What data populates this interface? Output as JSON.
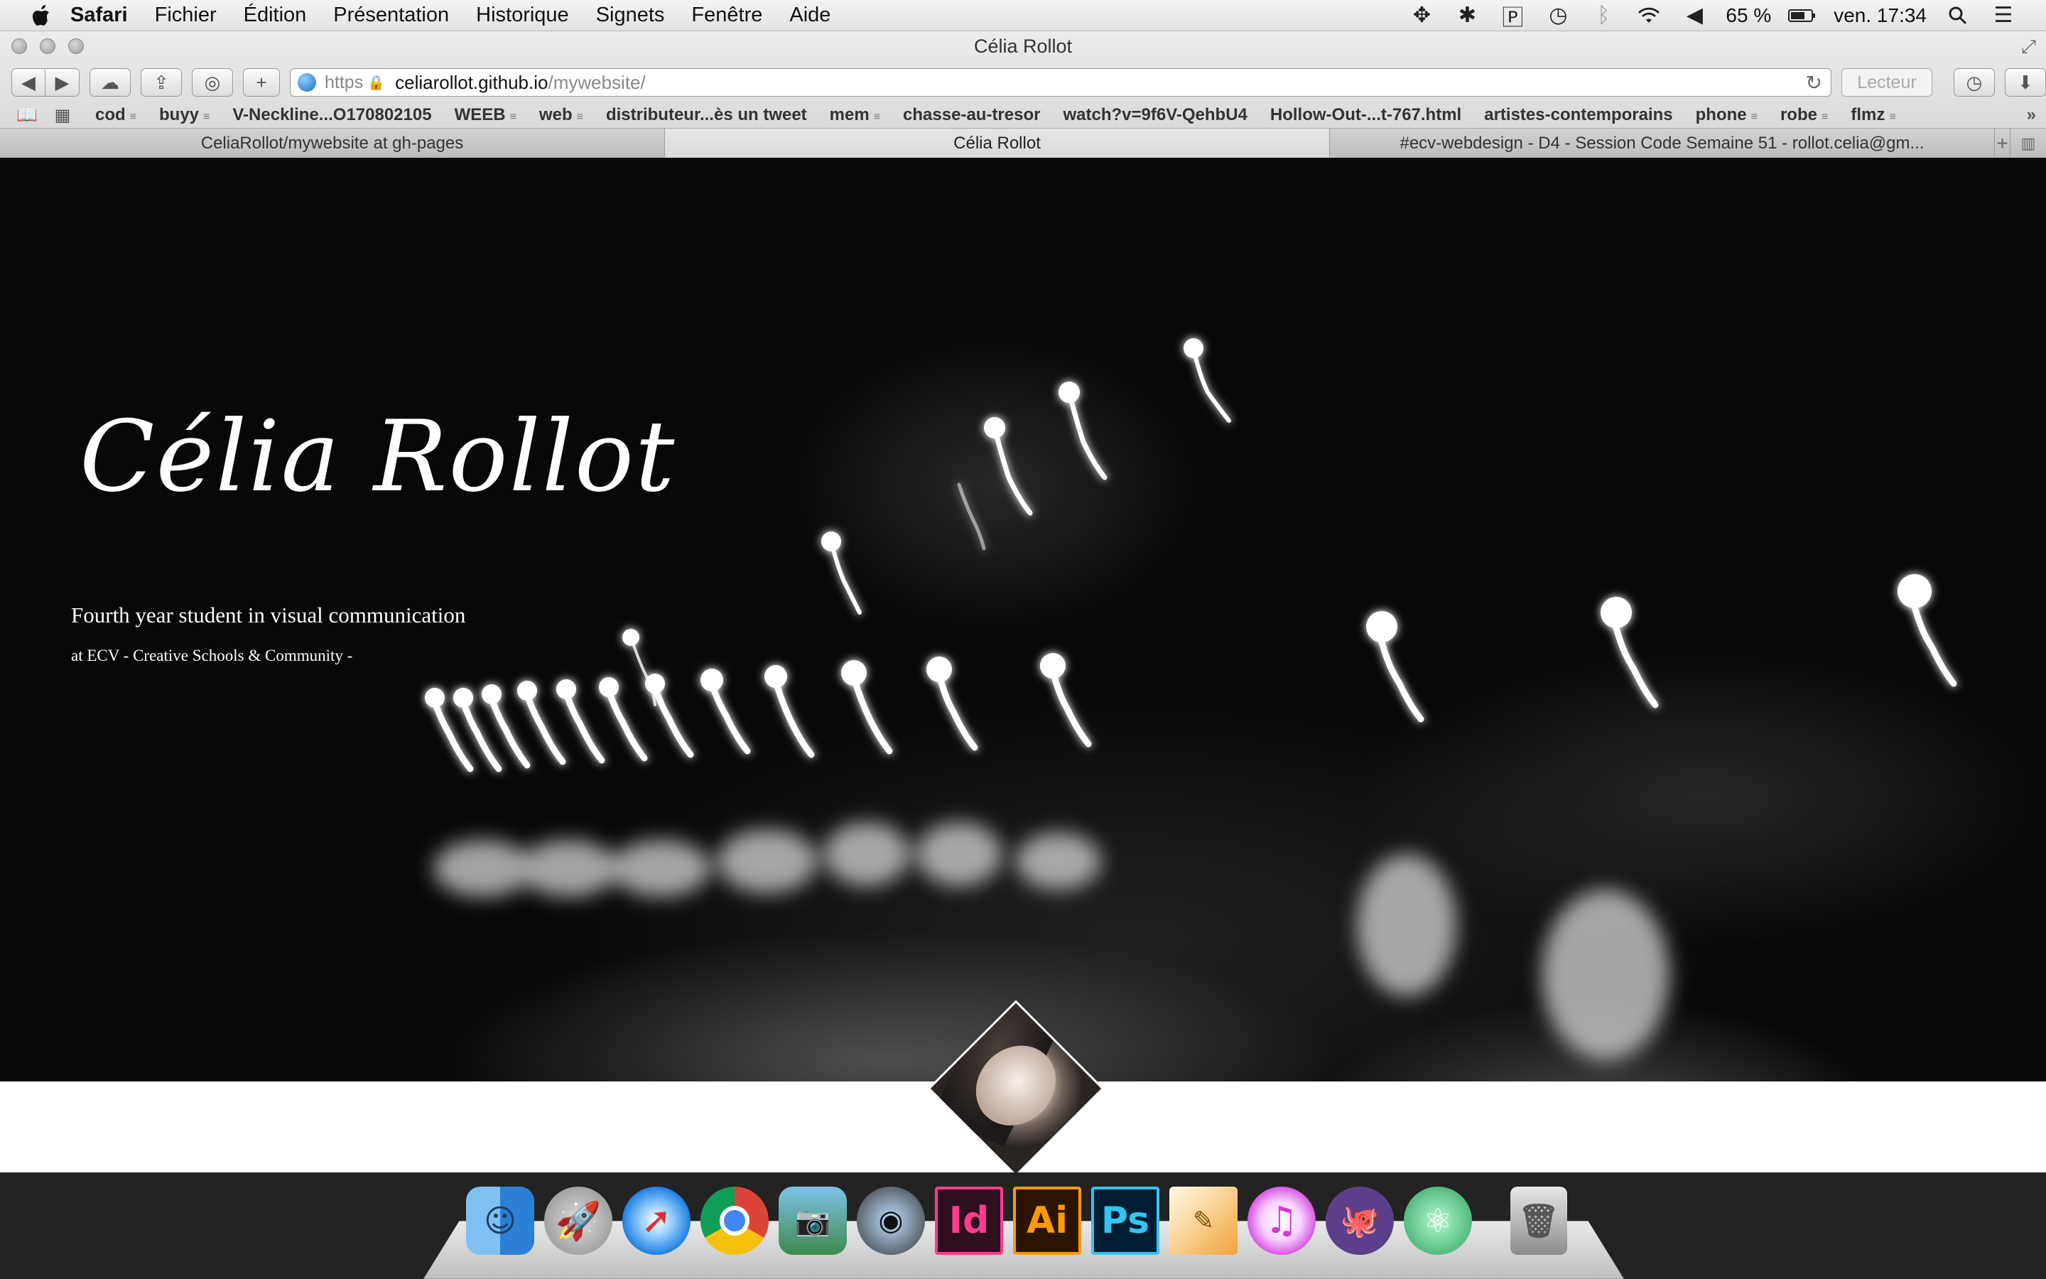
{
  "menubar": {
    "apple_icon": "apple-icon",
    "items": [
      "Safari",
      "Fichier",
      "Édition",
      "Présentation",
      "Historique",
      "Signets",
      "Fenêtre",
      "Aide"
    ],
    "battery": "65 %",
    "clock": "ven. 17:34"
  },
  "window": {
    "title": "Célia Rollot"
  },
  "toolbar": {
    "url_scheme": "https",
    "url_host": "celiarollot.github.io",
    "url_path": "/mywebsite/",
    "reader_label": "Lecteur"
  },
  "bookmarks": [
    {
      "label": "cod",
      "folder": true
    },
    {
      "label": "buyy",
      "folder": true
    },
    {
      "label": "V-Neckline...O170802105",
      "folder": false
    },
    {
      "label": "WEEB",
      "folder": true
    },
    {
      "label": "web",
      "folder": true
    },
    {
      "label": "distributeur...ès un tweet",
      "folder": false
    },
    {
      "label": "mem",
      "folder": true
    },
    {
      "label": "chasse-au-tresor",
      "folder": false
    },
    {
      "label": "watch?v=9f6V-QehbU4",
      "folder": false
    },
    {
      "label": "Hollow-Out-...t-767.html",
      "folder": false
    },
    {
      "label": "artistes-contemporains",
      "folder": false
    },
    {
      "label": "phone",
      "folder": true
    },
    {
      "label": "robe",
      "folder": true
    },
    {
      "label": "flmz",
      "folder": true
    }
  ],
  "tabs": [
    {
      "label": "CeliaRollot/mywebsite at gh-pages",
      "active": false
    },
    {
      "label": "Célia Rollot",
      "active": true
    },
    {
      "label": "#ecv-webdesign - D4 - Session Code Semaine 51 - rollot.celia@gm...",
      "active": false
    }
  ],
  "hero": {
    "title": "Célia Rollot",
    "subtitle": "Fourth year student in visual communication",
    "tagline": "at ECV - Creative Schools & Community -"
  },
  "dock": [
    "finder-icon",
    "launchpad-icon",
    "safari-icon",
    "chrome-icon",
    "iphoto-icon",
    "facetime-icon",
    "indesign-icon",
    "illustrator-icon",
    "photoshop-icon",
    "pages-icon",
    "itunes-icon",
    "github-icon",
    "atom-icon",
    "trash-icon"
  ],
  "dock_labels": {
    "indesign": "Id",
    "illustrator": "Ai",
    "photoshop": "Ps"
  }
}
